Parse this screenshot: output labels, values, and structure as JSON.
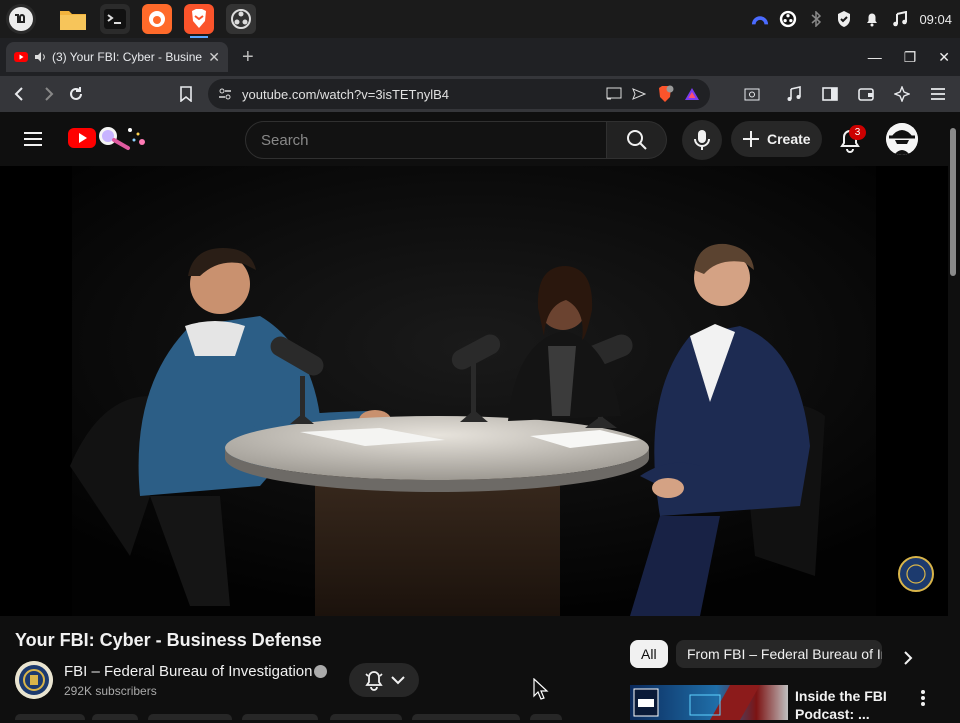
{
  "os": {
    "apps": [
      "menu-icon",
      "files-icon",
      "terminal-icon",
      "firefox-icon",
      "brave-icon",
      "obs-icon"
    ],
    "clock": "09:04"
  },
  "browser": {
    "tab_title": "(3) Your FBI: Cyber - Busine",
    "url": "youtube.com/watch?v=3isTETnylB4"
  },
  "youtube": {
    "search_placeholder": "Search",
    "create_label": "Create",
    "notification_count": "3",
    "video": {
      "title": "Your FBI: Cyber - Business Defense",
      "channel": "FBI – Federal Bureau of Investigation",
      "subscribers": "292K subscribers"
    },
    "chips": [
      "All",
      "From FBI – Federal Bureau of Inv"
    ],
    "recommended": {
      "title_line1": "Inside the FBI",
      "title_line2": "Podcast: ..."
    }
  },
  "colors": {
    "accent_red": "#ff0000",
    "background": "#0f0f0f",
    "badge": "#cc0000"
  }
}
